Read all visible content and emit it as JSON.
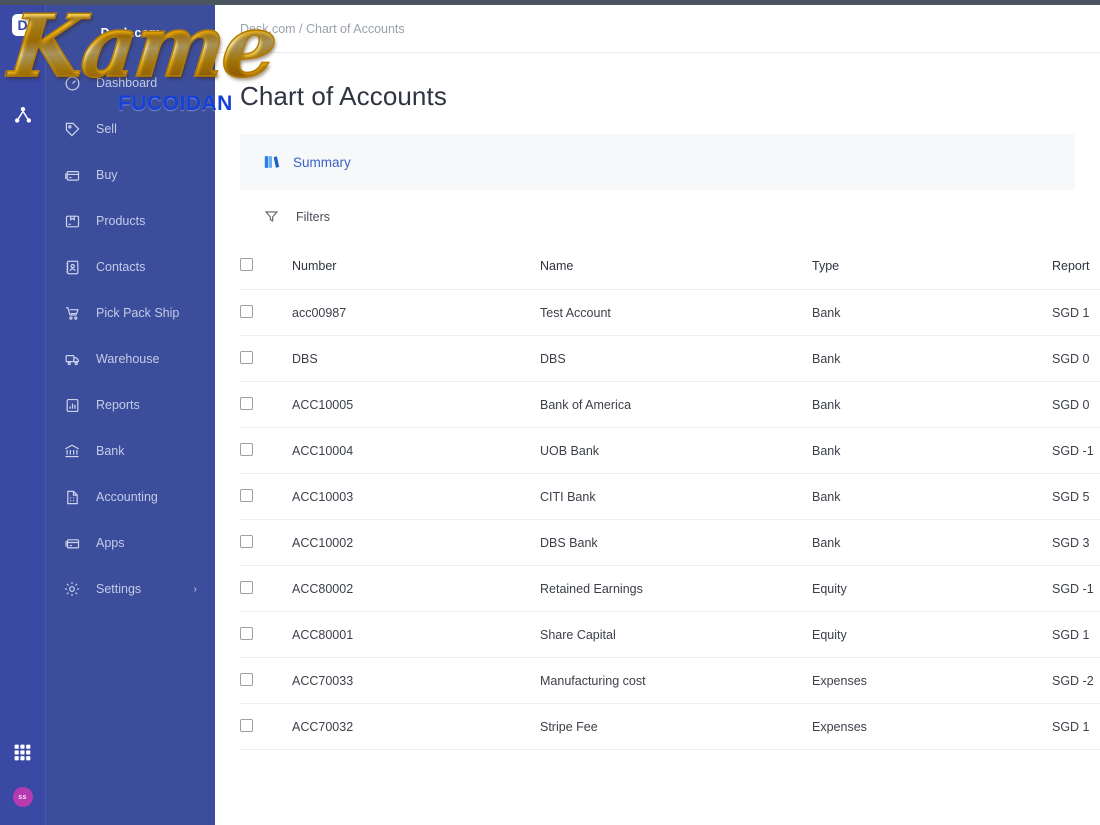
{
  "rail": {
    "logo_letter": "D",
    "icons": [
      {
        "name": "home-icon",
        "label": "Home"
      },
      {
        "name": "sitemap-icon",
        "label": "Organization"
      }
    ],
    "apps_icon": "grid-apps-icon",
    "avatar_initials": "ss"
  },
  "sidebar": {
    "brand": "Desk.com",
    "items": [
      {
        "label": "Dashboard",
        "icon": "dashboard-icon",
        "caret": ""
      },
      {
        "label": "Sell",
        "icon": "tag-icon",
        "caret": ""
      },
      {
        "label": "Buy",
        "icon": "card-icon",
        "caret": ""
      },
      {
        "label": "Products",
        "icon": "box-icon",
        "caret": ""
      },
      {
        "label": "Contacts",
        "icon": "contacts-book-icon",
        "caret": ""
      },
      {
        "label": "Pick Pack Ship",
        "icon": "pick-pack-ship-icon",
        "caret": ""
      },
      {
        "label": "Warehouse",
        "icon": "warehouse-truck-icon",
        "caret": ""
      },
      {
        "label": "Reports",
        "icon": "bar-chart-icon",
        "caret": ""
      },
      {
        "label": "Bank",
        "icon": "bank-icon",
        "caret": ""
      },
      {
        "label": "Accounting",
        "icon": "accounting-doc-icon",
        "caret": ""
      },
      {
        "label": "Apps",
        "icon": "apps-icon",
        "caret": ""
      },
      {
        "label": "Settings",
        "icon": "gear-icon",
        "caret": "›"
      }
    ]
  },
  "watermark": {
    "script_text": "Kame",
    "sub_text": "FUCOIDAN"
  },
  "header": {
    "breadcrumb": "Desk.com / Chart of Accounts",
    "title": "Chart of Accounts"
  },
  "tabs": [
    {
      "label": "Summary",
      "icon": "summary-books-icon",
      "active": true
    }
  ],
  "toolbar": {
    "filters_label": "Filters",
    "filters_icon": "funnel-icon"
  },
  "table": {
    "columns": [
      "Number",
      "Name",
      "Type",
      "Report"
    ],
    "rows": [
      {
        "number": "acc00987",
        "name": "Test Account",
        "type": "Bank",
        "report": "SGD  1",
        "negative": false
      },
      {
        "number": "DBS",
        "name": "DBS",
        "type": "Bank",
        "report": "SGD  0",
        "negative": false
      },
      {
        "number": "ACC10005",
        "name": "Bank of America",
        "type": "Bank",
        "report": "SGD  0",
        "negative": false
      },
      {
        "number": "ACC10004",
        "name": "UOB Bank",
        "type": "Bank",
        "report": "SGD  -1",
        "negative": true
      },
      {
        "number": "ACC10003",
        "name": "CITI Bank",
        "type": "Bank",
        "report": "SGD  5",
        "negative": false
      },
      {
        "number": "ACC10002",
        "name": "DBS Bank",
        "type": "Bank",
        "report": "SGD  3",
        "negative": false
      },
      {
        "number": "ACC80002",
        "name": "Retained Earnings",
        "type": "Equity",
        "report": "SGD  -1",
        "negative": true
      },
      {
        "number": "ACC80001",
        "name": "Share Capital",
        "type": "Equity",
        "report": "SGD  1",
        "negative": false
      },
      {
        "number": "ACC70033",
        "name": "Manufacturing cost",
        "type": "Expenses",
        "report": "SGD  -2",
        "negative": true
      },
      {
        "number": "ACC70032",
        "name": "Stripe Fee",
        "type": "Expenses",
        "report": "SGD  1",
        "negative": false
      }
    ]
  },
  "colors": {
    "sidebar": "#3c4e9b",
    "rail": "#3a49a4",
    "accent_link": "#3a62c4",
    "negative": "#e0564f",
    "avatar": "#b63ab0",
    "watermark_sub": "#1442d8"
  }
}
